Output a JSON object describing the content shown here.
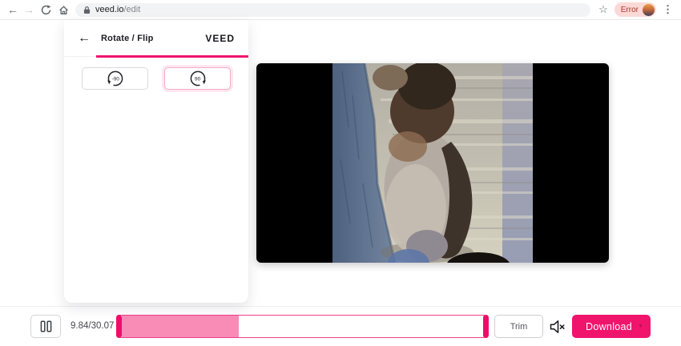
{
  "browser": {
    "url": {
      "host": "veed.io",
      "path": "/edit"
    },
    "profile_badge": "Error",
    "icons": {
      "back": "←",
      "forward": "→",
      "refresh": "refresh-circular-arrow",
      "home": "house-outline",
      "lock": "padlock",
      "bookmark": "☆",
      "menu": "⋮"
    }
  },
  "panel": {
    "back_icon": "←",
    "title": "Rotate / Flip",
    "logo": "VEED",
    "rotate_buttons": [
      {
        "label": "-90",
        "direction": "counterclockwise",
        "selected": false
      },
      {
        "label": "90",
        "direction": "clockwise",
        "selected": true
      }
    ]
  },
  "player": {
    "pause_icon": "pause-two-bars",
    "time": "9.84/30.07",
    "progress_percent": 32.4,
    "trim_label": "Trim",
    "mute_icon": "speaker-muted",
    "download_label": "Download",
    "caret_icon": "▼"
  },
  "colors": {
    "accent": "#f1146d",
    "timeline_fill": "#f98bb7",
    "timeline_border": "#f0418a",
    "trim_handle": "#ee0e6a",
    "selected_button_border": "#f2aac6",
    "error_badge_bg": "#fbd9d6",
    "error_badge_text": "#b4372e"
  }
}
